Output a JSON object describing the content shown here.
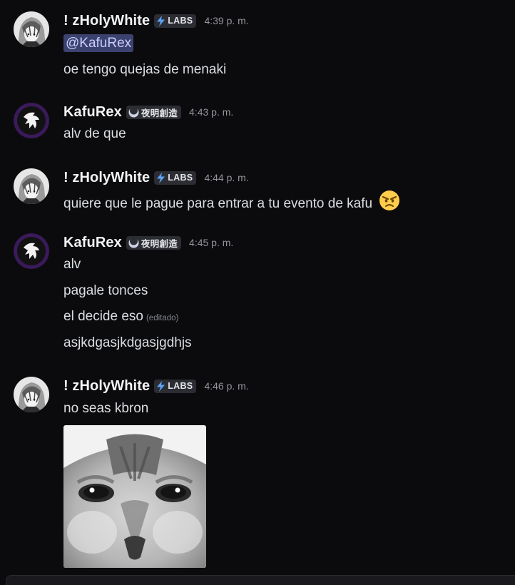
{
  "messages": [
    {
      "author": "! zHolyWhite",
      "tag": "LABS",
      "tag_icon": "lightning-bolt-icon",
      "time": "4:39 p. m.",
      "mention": "@KafuRex",
      "lines": [
        "oe tengo quejas de menaki"
      ]
    },
    {
      "author": "KafuRex",
      "tag": "夜明創造",
      "tag_icon": "crescent-moon-icon",
      "time": "4:43 p. m.",
      "lines": [
        "alv de que"
      ]
    },
    {
      "author": "! zHolyWhite",
      "tag": "LABS",
      "tag_icon": "lightning-bolt-icon",
      "time": "4:44 p. m.",
      "lines": [
        "quiere que le pague para entrar a tu evento de kafu"
      ],
      "emoji": "angry-face-emoji"
    },
    {
      "author": "KafuRex",
      "tag": "夜明創造",
      "tag_icon": "crescent-moon-icon",
      "time": "4:45 p. m.",
      "lines": [
        "alv",
        "pagale tonces",
        "el decide eso",
        "asjkdgasjkdgasjgdhjs"
      ],
      "edited_label": "(editado)"
    },
    {
      "author": "! zHolyWhite",
      "tag": "LABS",
      "tag_icon": "lightning-bolt-icon",
      "time": "4:46 p. m.",
      "lines": [
        "no seas kbron"
      ],
      "attachment": "cat-face-image"
    }
  ],
  "colors": {
    "background": "#0b0b0e",
    "username": "#f2f3f5",
    "text": "#dbdee1",
    "timestamp": "#94959c",
    "mention_bg": "#3c4270",
    "mention_text": "#c9cdfb",
    "tag_bg": "#2b2d33",
    "labs_bolt": "#5ba4f5"
  }
}
